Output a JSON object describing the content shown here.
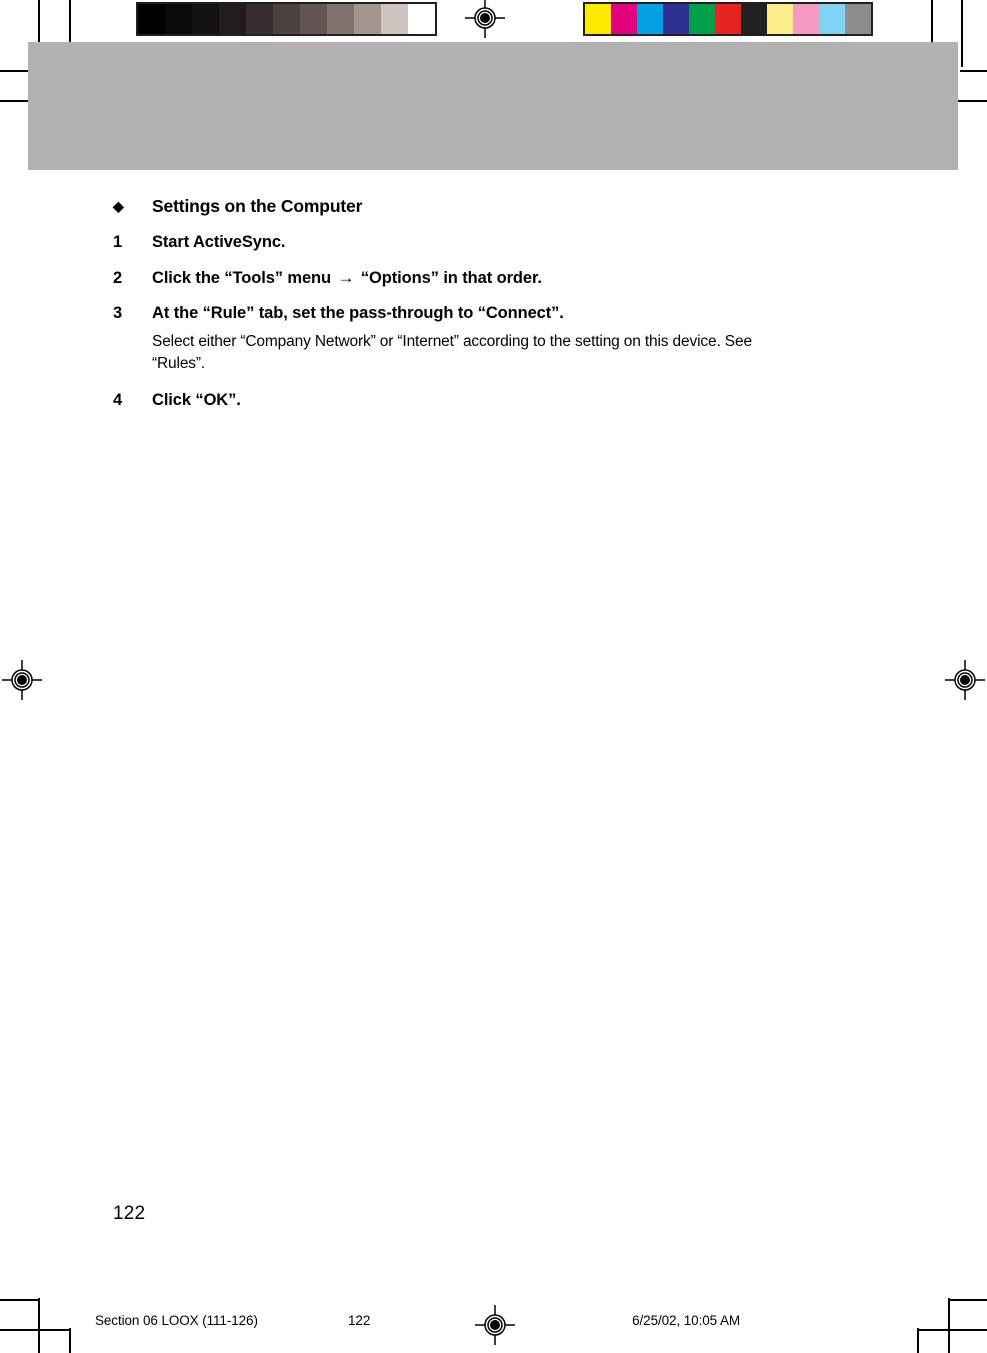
{
  "document": {
    "page_number": "122"
  },
  "calibration": {
    "gray_strip_name": "grayscale-calibration-strip",
    "gray_patches": [
      "#000000",
      "#0b0909",
      "#151111",
      "#221d1c",
      "#372f2d",
      "#4c4240",
      "#625553",
      "#80736f",
      "#a2958f",
      "#d0c4c0",
      "#ffffff"
    ],
    "color_strip_name": "color-calibration-strip",
    "color_patches": [
      "#fbe900",
      "#e5007e",
      "#00a0e4",
      "#2e3192",
      "#00a04b",
      "#e52320",
      "#231f20",
      "#fbee8a",
      "#f49ac1",
      "#7fd4f5",
      "#8d8d8d"
    ]
  },
  "header": {
    "band_color": "#b2b2b2"
  },
  "content": {
    "heading": {
      "bullet": "◆",
      "text": "Settings on the Computer"
    },
    "steps": [
      {
        "number": "1",
        "text": "Start ActiveSync.",
        "note": null
      },
      {
        "number": "2",
        "text_before_arrow": "Click the “Tools” menu ",
        "arrow": "→",
        "text_after_arrow": " “Options” in that order.",
        "note": null
      },
      {
        "number": "3",
        "text": "At the “Rule” tab, set the pass-through to “Connect”.",
        "note": "Select either “Company Network” or “Internet” according to the setting on this device. See “Rules”."
      },
      {
        "number": "4",
        "text": "Click “OK”.",
        "note": null
      }
    ]
  },
  "print_footer": {
    "section_label": "Section 06 LOOX (111-126)",
    "page": "122",
    "timestamp": "6/25/02, 10:05 AM"
  }
}
